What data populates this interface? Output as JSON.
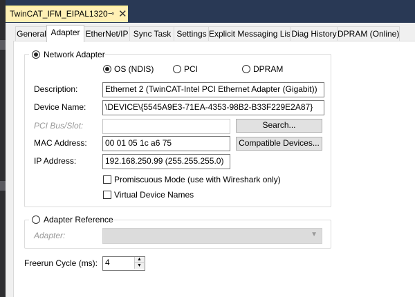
{
  "document_tab": {
    "title": "TwinCAT_IFM_EIPAL1320",
    "pin_glyph": "⊸",
    "close_glyph": "✕"
  },
  "tabs": [
    {
      "label": "General",
      "active": false
    },
    {
      "label": "Adapter",
      "active": true
    },
    {
      "label": "EtherNet/IP",
      "active": false
    },
    {
      "label": "Sync Task",
      "active": false
    },
    {
      "label": "Settings",
      "active": false
    },
    {
      "label": "Explicit Messaging List",
      "active": false
    },
    {
      "label": "Diag History",
      "active": false
    },
    {
      "label": "DPRAM (Online)",
      "active": false
    }
  ],
  "network_adapter": {
    "label": "Network Adapter",
    "selected": true,
    "modes": [
      {
        "label": "OS (NDIS)",
        "selected": true
      },
      {
        "label": "PCI",
        "selected": false
      },
      {
        "label": "DPRAM",
        "selected": false
      }
    ],
    "description": {
      "label": "Description:",
      "value": "Ethernet 2 (TwinCAT-Intel PCI Ethernet Adapter (Gigabit))"
    },
    "device_name": {
      "label": "Device Name:",
      "value": "\\DEVICE\\{5545A9E3-71EA-4353-98B2-B33F229E2A87}"
    },
    "pci_bus_slot": {
      "label": "PCI Bus/Slot:",
      "value": "",
      "disabled": true
    },
    "search_button": "Search...",
    "mac_address": {
      "label": "MAC Address:",
      "value": "00 01 05 1c a6 75"
    },
    "compatible_button": "Compatible Devices...",
    "ip_address": {
      "label": "IP Address:",
      "value": "192.168.250.99 (255.255.255.0)"
    },
    "promiscuous": {
      "label": "Promiscuous Mode (use with Wireshark only)",
      "checked": false
    },
    "virtual_names": {
      "label": "Virtual Device Names",
      "checked": false
    }
  },
  "adapter_reference": {
    "label": "Adapter Reference",
    "selected": false,
    "adapter_label": "Adapter:",
    "adapter_value": ""
  },
  "freerun": {
    "label": "Freerun Cycle (ms):",
    "value": "4"
  },
  "colors": {
    "ide_band": "#293955",
    "doc_tab": "#fff0b4",
    "pane": "#f0f0f0"
  }
}
